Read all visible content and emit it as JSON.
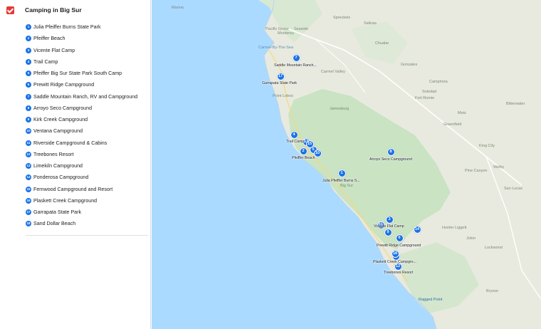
{
  "layer": {
    "title": "Camping in Big Sur",
    "checked": true,
    "accent": "#e53935",
    "marker_color": "#1a73e8"
  },
  "items": [
    {
      "num": "1",
      "label": "Julia Pfeiffer Burns State Park"
    },
    {
      "num": "2",
      "label": "Pfeiffer Beach"
    },
    {
      "num": "3",
      "label": "Vicente Flat Camp"
    },
    {
      "num": "4",
      "label": "Trail Camp"
    },
    {
      "num": "5",
      "label": "Pfeiffer Big Sur State Park South Camp"
    },
    {
      "num": "6",
      "label": "Prewitt Ridge Campground"
    },
    {
      "num": "7",
      "label": "Saddle Mountain Ranch, RV and Campground"
    },
    {
      "num": "8",
      "label": "Arroyo Seco Campground"
    },
    {
      "num": "9",
      "label": "Kirk Creek Campground"
    },
    {
      "num": "10",
      "label": "Ventana Campground"
    },
    {
      "num": "11",
      "label": "Riverside Campground & Cabins"
    },
    {
      "num": "12",
      "label": "Treebones Resort"
    },
    {
      "num": "13",
      "label": "Limekiln Campground"
    },
    {
      "num": "14",
      "label": "Ponderosa Campground"
    },
    {
      "num": "15",
      "label": "Fernwood Campground and Resort"
    },
    {
      "num": "16",
      "label": "Plaskett Creek Campground"
    },
    {
      "num": "17",
      "label": "Garrapata State Park"
    },
    {
      "num": "18",
      "label": "Sand Dollar Beach"
    }
  ],
  "map": {
    "places": [
      "Marina",
      "Salinas",
      "Spreckels",
      "Pacific Grove",
      "Monterey",
      "Seaside",
      "Carmel-By-The-Sea",
      "Chualar",
      "Carmel Valley",
      "Gonzales",
      "Chualar",
      "Soledad",
      "Fort Romie",
      "Camphora",
      "Greenfield",
      "Metz",
      "Bitterwater",
      "Jamesburg",
      "Point Lobos",
      "Mission Ranch",
      "King City",
      "Pine Canyon",
      "Welby",
      "San Lucas",
      "Hunter Liggett",
      "Jolon",
      "Lockwood",
      "Bryson",
      "Big Sur",
      "Lucia",
      "Ragged Point",
      "Gorda"
    ],
    "marker_labels": {
      "7": "Saddle Mountain Ranch...",
      "17": "Garrapata State Park",
      "4": "Trail Camp",
      "2": "Pfeiffer Beach",
      "8": "Arroyo Seco Campground",
      "1": "Julia Pfeiffer Burns S...",
      "3": "Vicente Flat Camp",
      "6": "Prewitt Ridge Campground",
      "16": "Plaskett Creek Campgro...",
      "12": "Treebones Resort"
    }
  }
}
